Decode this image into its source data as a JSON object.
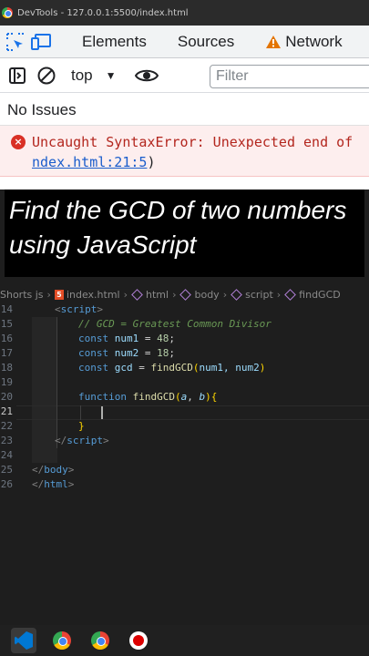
{
  "titlebar": {
    "title": "DevTools - 127.0.0.1:5500/index.html"
  },
  "devtools": {
    "tabs": [
      {
        "label": "Elements"
      },
      {
        "label": "Sources"
      },
      {
        "label": "Network"
      }
    ],
    "console_toolbar": {
      "context": "top",
      "filter_placeholder": "Filter"
    },
    "issues_text": "No Issues",
    "error": {
      "message": "Uncaught SyntaxError: Unexpected end of",
      "link": "ndex.html:21:5",
      "link_tail": ")"
    }
  },
  "caption": {
    "line1": "Find the GCD of two numbers",
    "line2": "using JavaScript"
  },
  "editor": {
    "breadcrumbs": [
      "Shorts js",
      "index.html",
      "html",
      "body",
      "script",
      "findGCD"
    ],
    "line_numbers": [
      "14",
      "15",
      "16",
      "17",
      "18",
      "19",
      "20",
      "21",
      "22",
      "23",
      "24",
      "25",
      "26"
    ],
    "code": {
      "l14_tag": "script",
      "l15_comment": "// GCD = Greatest Common Divisor",
      "l16_kw": "const",
      "l16_var": "num1",
      "l16_num": "48",
      "l17_kw": "const",
      "l17_var": "num2",
      "l17_num": "18",
      "l18_kw": "const",
      "l18_var": "gcd",
      "l18_fn": "findGCD",
      "l18_args": "num1, num2",
      "l20_kw": "function",
      "l20_fn": "findGCD",
      "l20_p1": "a",
      "l20_p2": "b",
      "l23_tag": "script",
      "l25_tag": "body",
      "l26_tag": "html"
    }
  },
  "taskbar": {
    "apps": [
      "vscode-icon",
      "chrome-icon",
      "chrome-icon",
      "record-icon"
    ]
  }
}
